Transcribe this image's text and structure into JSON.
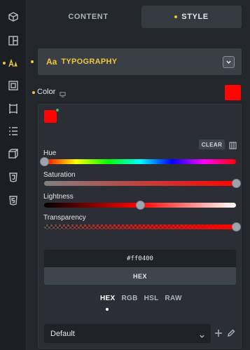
{
  "sidebar": {
    "items": [
      {
        "icon": "cube-icon"
      },
      {
        "icon": "layout-icon"
      },
      {
        "icon": "typography-icon",
        "active": true
      },
      {
        "icon": "spacing-icon"
      },
      {
        "icon": "border-icon"
      },
      {
        "icon": "effects-icon"
      },
      {
        "icon": "transform-icon"
      },
      {
        "icon": "css3-icon"
      },
      {
        "icon": "html5-icon"
      }
    ],
    "accent_color": "#f0c63b"
  },
  "tabs": [
    {
      "label": "CONTENT",
      "active": false
    },
    {
      "label": "STYLE",
      "active": true
    }
  ],
  "section": {
    "icon_glyph": "Aa",
    "title": "TYPOGRAPHY",
    "expanded": true
  },
  "color_control": {
    "label": "Color",
    "value_color": "#ff0400"
  },
  "picker": {
    "clear_label": "CLEAR",
    "sliders": {
      "hue": {
        "label": "Hue",
        "value_fraction": 0.0
      },
      "saturation": {
        "label": "Saturation",
        "value_fraction": 1.0
      },
      "lightness": {
        "label": "Lightness",
        "value_fraction": 0.5
      },
      "transparency": {
        "label": "Transparency",
        "value_fraction": 1.0
      }
    },
    "hex_value": "#ff0400",
    "hex_caption": "HEX",
    "modes": [
      "HEX",
      "RGB",
      "HSL",
      "RAW"
    ],
    "active_mode": "HEX",
    "preset": "Default"
  }
}
